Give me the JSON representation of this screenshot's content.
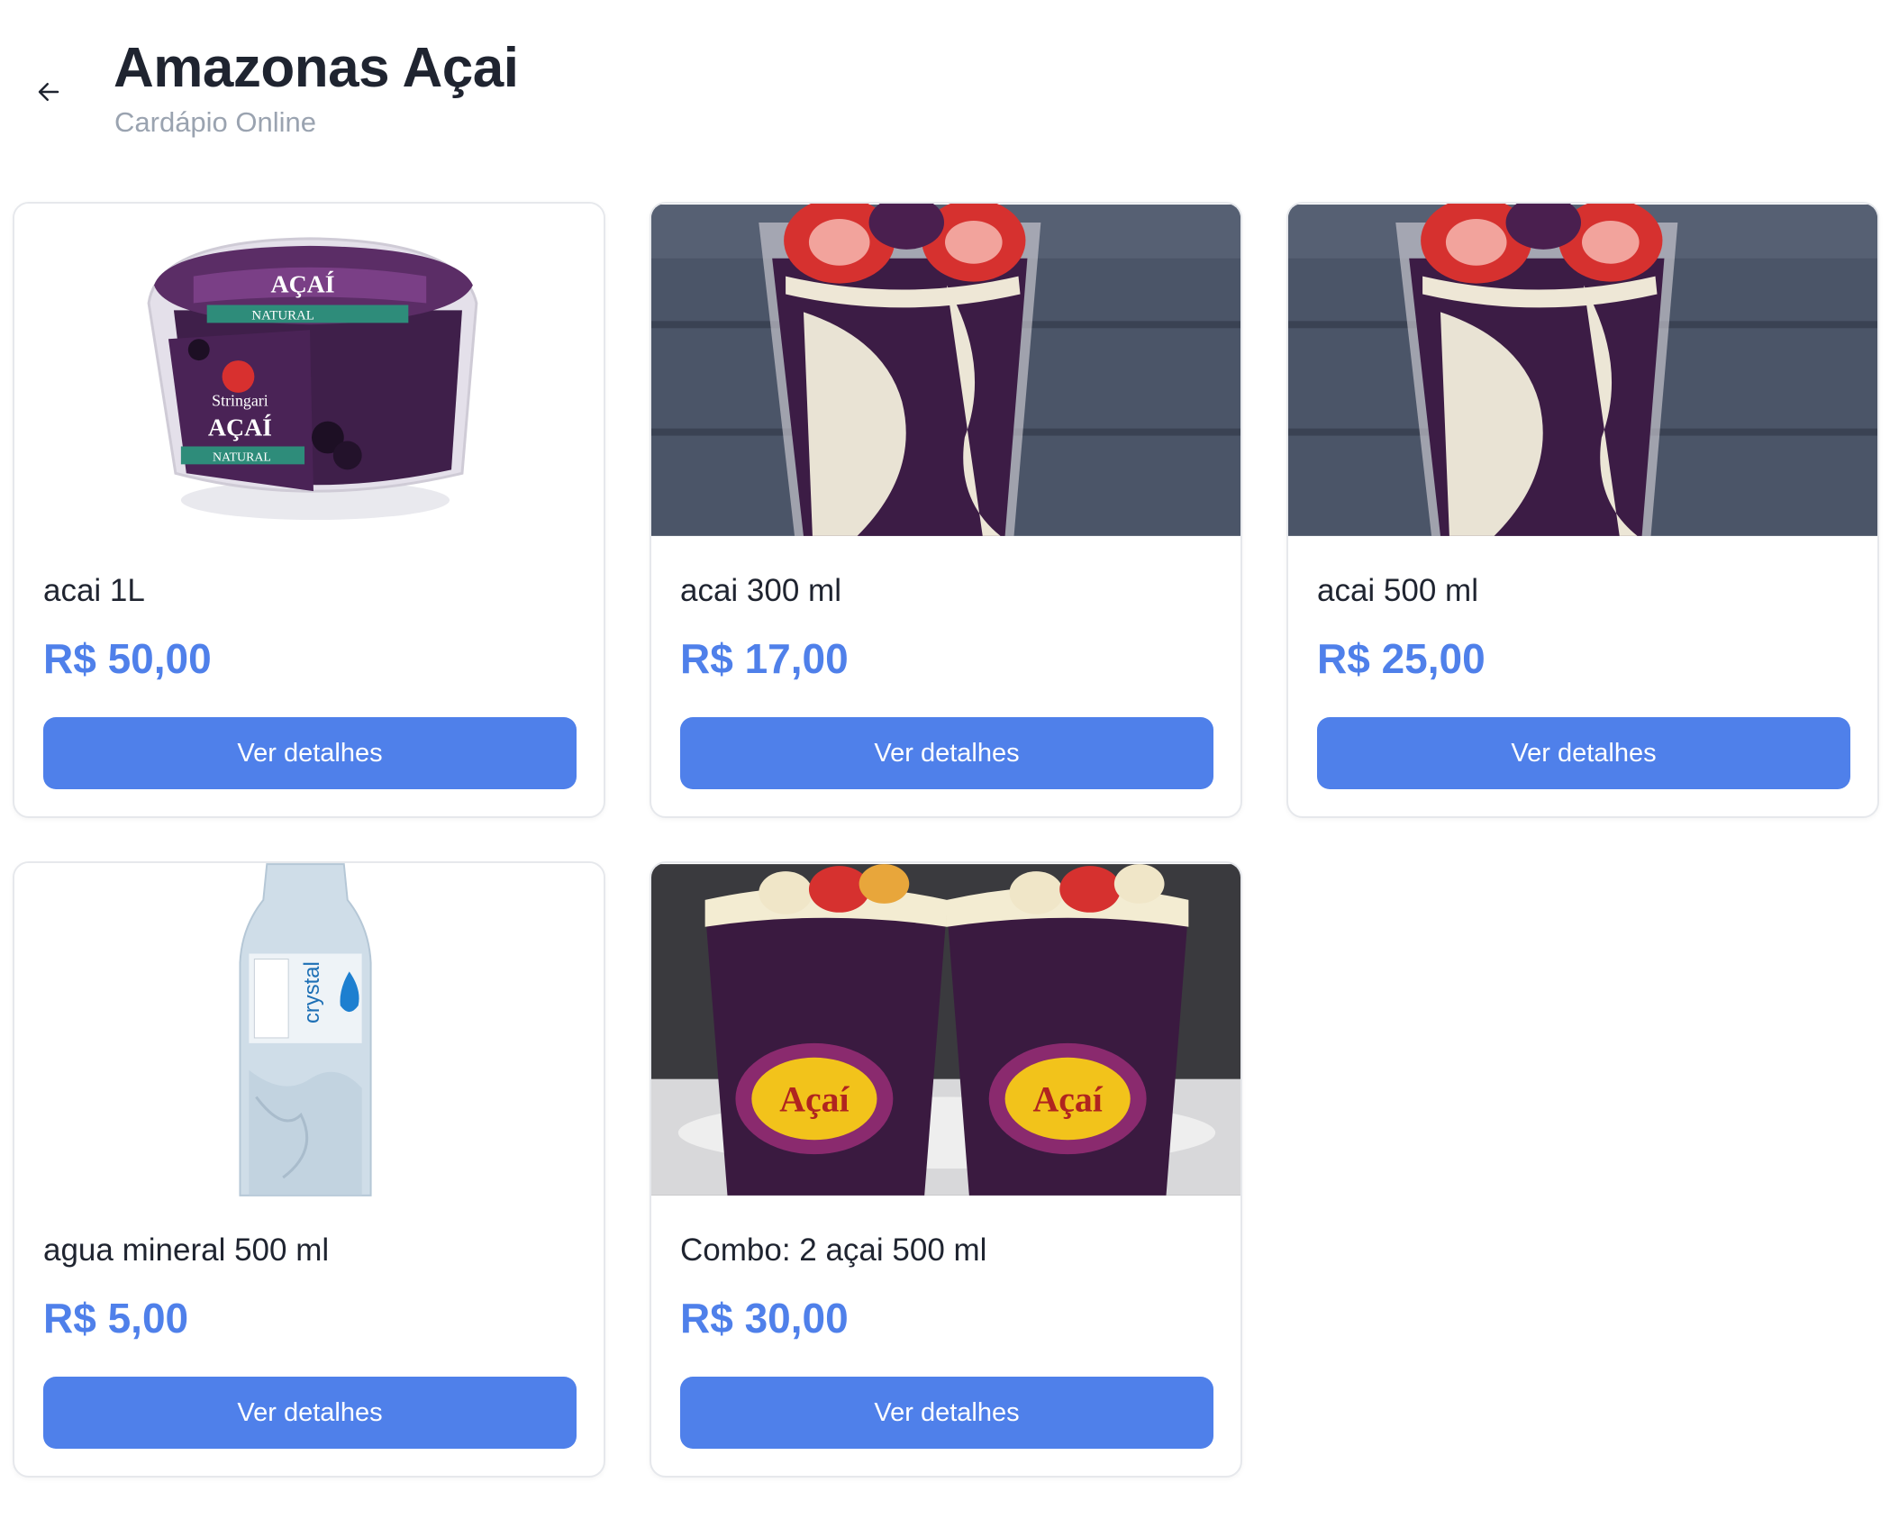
{
  "header": {
    "back_icon": "arrow-left-icon",
    "title": "Amazonas Açai",
    "subtitle": "Cardápio Online"
  },
  "colors": {
    "accent": "#4f80ea",
    "title": "#1f2430",
    "subtitle": "#9aa3b0",
    "card_border": "#e6e8ec"
  },
  "products": [
    {
      "name": "acai 1L",
      "price": "R$ 50,00",
      "button_label": "Ver detalhes",
      "image": "acai-tub-image",
      "image_text_brand": "Stringari",
      "image_text_product": "AÇAÍ",
      "image_text_variant": "NATURAL"
    },
    {
      "name": "acai 300 ml",
      "price": "R$ 17,00",
      "button_label": "Ver detalhes",
      "image": "acai-cup-strawberry-image"
    },
    {
      "name": "acai 500 ml",
      "price": "R$ 25,00",
      "button_label": "Ver detalhes",
      "image": "acai-cup-strawberry-image"
    },
    {
      "name": "agua mineral 500 ml",
      "price": "R$ 5,00",
      "button_label": "Ver detalhes",
      "image": "water-bottle-image",
      "image_text_brand": "crystal"
    },
    {
      "name": "Combo: 2 açai 500 ml",
      "price": "R$ 30,00",
      "button_label": "Ver detalhes",
      "image": "acai-combo-cups-image",
      "image_text_brand": "Açaí"
    }
  ]
}
